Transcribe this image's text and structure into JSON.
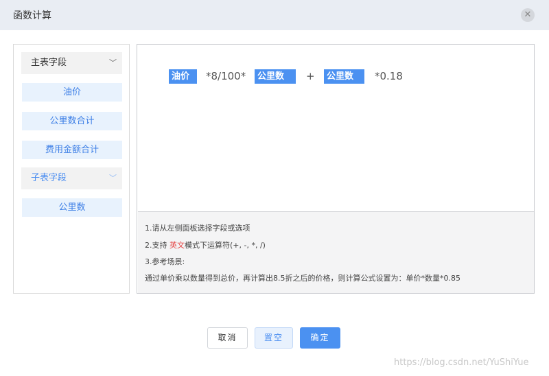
{
  "dialog": {
    "title": "函数计算",
    "close_icon": "close-icon"
  },
  "left_panel": {
    "main_section_label": "主表字段",
    "main_fields": [
      "油价",
      "公里数合计",
      "费用金额合计"
    ],
    "sub_section_label": "子表字段",
    "sub_fields": [
      "公里数"
    ]
  },
  "formula": {
    "tokens": [
      {
        "type": "field",
        "text": "油价"
      },
      {
        "type": "text",
        "text": "*8/100*"
      },
      {
        "type": "field",
        "text": "公里数"
      },
      {
        "type": "text",
        "text": "+"
      },
      {
        "type": "field",
        "text": "公里数"
      },
      {
        "type": "text",
        "text": "*0.18"
      }
    ]
  },
  "help": {
    "line1": "1.请从左侧面板选择字段或选项",
    "line2_prefix": "2.支持 ",
    "line2_highlight": "英文",
    "line2_suffix": "模式下运算符(+, -, *, /)",
    "line3": "3.参考场景:",
    "line4": "通过单价乘以数量得到总价，再计算出8.5折之后的价格，则计算公式设置为：单价*数量*0.85"
  },
  "buttons": {
    "cancel": "取消",
    "clear": "置空",
    "confirm": "确定"
  },
  "watermark": "https://blog.csdn.net/YuShiYue",
  "colors": {
    "accent": "#4b91f1",
    "highlight_red": "#e44343"
  }
}
